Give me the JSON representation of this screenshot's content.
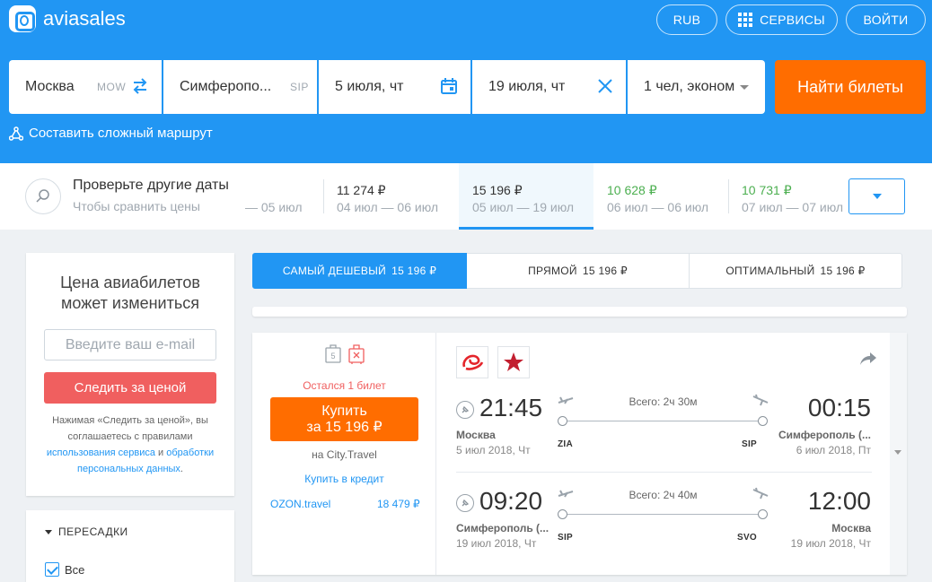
{
  "header": {
    "logo_text": "aviasales",
    "currency_button": "RUB",
    "services_button": "СЕРВИСЫ",
    "login_button": "ВОЙТИ"
  },
  "search": {
    "origin": "Москва",
    "origin_code": "MOW",
    "destination": "Симферопо...",
    "destination_code": "SIP",
    "depart_date": "5 июля, чт",
    "return_date": "19 июля, чт",
    "passengers": "1 чел, эконом",
    "find_button": "Найти билеты",
    "complex_route": "Составить сложный маршрут"
  },
  "date_strip": {
    "title": "Проверьте другие даты",
    "subtitle": "Чтобы сравнить цены",
    "cells": [
      {
        "price": "",
        "dates": "— 05 июл"
      },
      {
        "price": "11 274 ₽",
        "dates": "04 июл — 06 июл"
      },
      {
        "price": "15 196 ₽",
        "dates": "05 июл — 19 июл"
      },
      {
        "price": "10 628 ₽",
        "dates": "06 июл — 06 июл"
      },
      {
        "price": "10 731 ₽",
        "dates": "07 июл — 07 июл"
      }
    ]
  },
  "subscribe": {
    "title_line1": "Цена авиабилетов",
    "title_line2": "может измениться",
    "email_placeholder": "Введите ваш e-mail",
    "track_button": "Следить за ценой",
    "notice_part1": "Нажимая «Следить за ценой», вы соглашаетесь с правилами",
    "notice_link1": "использования сервиса",
    "notice_and": "и",
    "notice_link2": "обработки персональных данных",
    "notice_end": "."
  },
  "filters": {
    "transfers_title": "ПЕРЕСАДКИ",
    "all_label": "Все"
  },
  "tabs": [
    {
      "label": "САМЫЙ ДЕШЕВЫЙ",
      "price": "15 196 ₽"
    },
    {
      "label": "ПРЯМОЙ",
      "price": "15 196 ₽"
    },
    {
      "label": "ОПТИМАЛЬНЫЙ",
      "price": "15 196 ₽"
    }
  ],
  "ticket": {
    "tickets_left": "Остался 1 билет",
    "buy_line1": "Купить",
    "buy_line2": "за 15 196 ₽",
    "seller": "на City.Travel",
    "credit": "Купить в кредит",
    "alt_agent": "OZON.travel",
    "alt_price": "18 479 ₽",
    "bag_count": "5",
    "segments": [
      {
        "dep_time": "21:45",
        "dep_city": "Москва",
        "dep_date": "5 июл 2018, Чт",
        "dep_code": "ZIA",
        "total": "Всего: 2ч 30м",
        "arr_time": "00:15",
        "arr_city": "Симферополь (...",
        "arr_date": "6 июл 2018, Пт",
        "arr_code": "SIP"
      },
      {
        "dep_time": "09:20",
        "dep_city": "Симферополь (...",
        "dep_date": "19 июл 2018, Чт",
        "dep_code": "SIP",
        "total": "Всего: 2ч 40м",
        "arr_time": "12:00",
        "arr_city": "Москва",
        "arr_date": "19 июл 2018, Чт",
        "arr_code": "SVO"
      }
    ]
  },
  "colors": {
    "brand_blue": "#2196f3",
    "cta_orange": "#ff6d00",
    "alert_red": "#f05f5f",
    "cheap_green": "#4caf50"
  }
}
